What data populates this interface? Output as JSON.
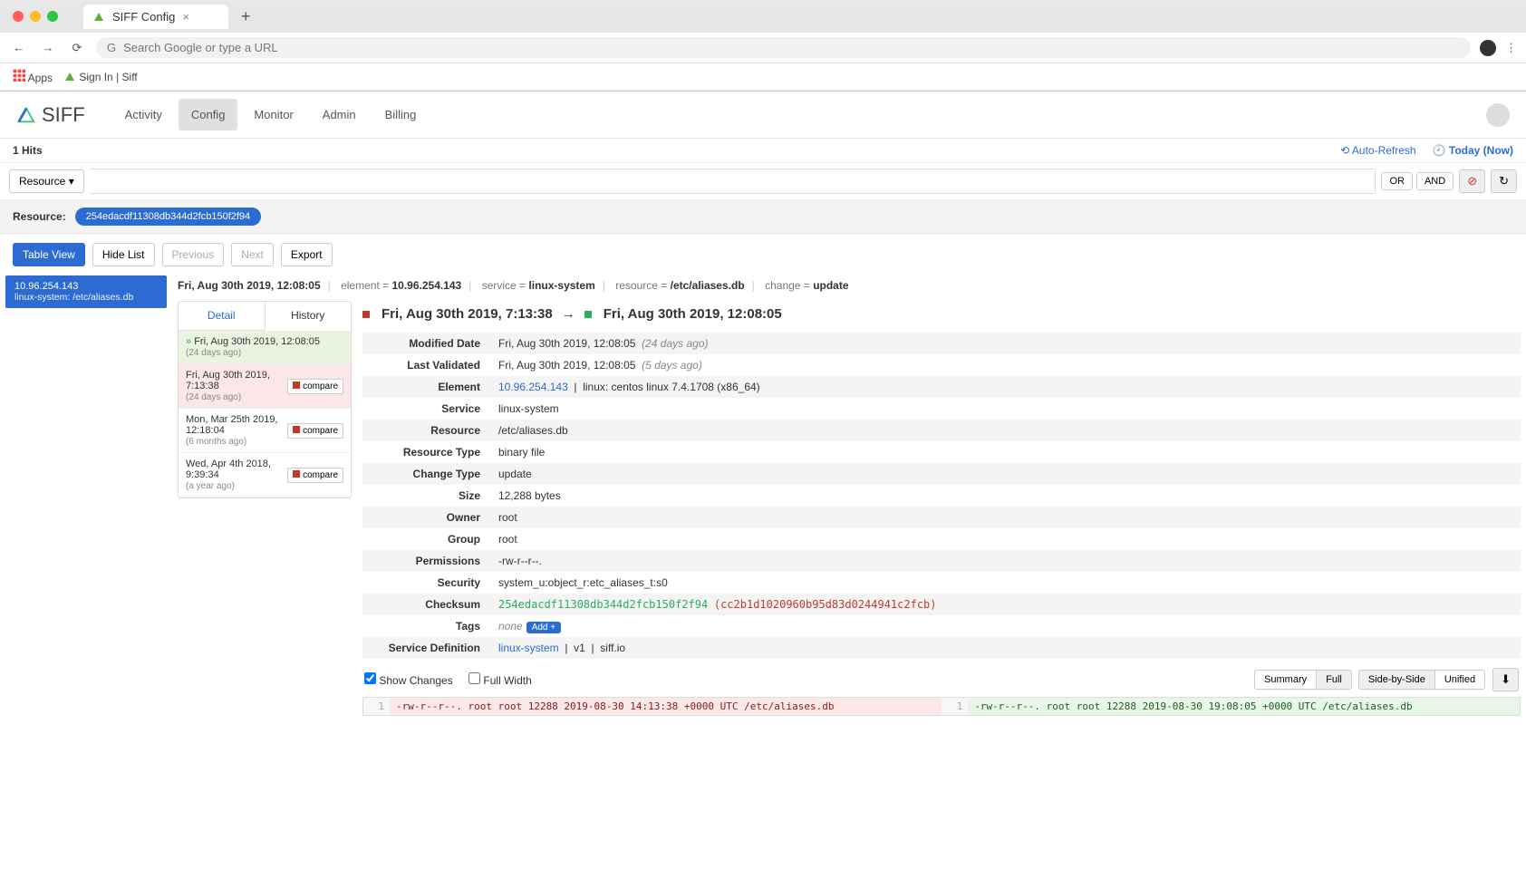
{
  "browser": {
    "tab_title": "SIFF Config",
    "omnibox_placeholder": "Search Google or type a URL",
    "bookmarks": {
      "apps": "Apps",
      "signin": "Sign In | Siff"
    }
  },
  "brand": "SIFF",
  "nav": {
    "activity": "Activity",
    "config": "Config",
    "monitor": "Monitor",
    "admin": "Admin",
    "billing": "Billing"
  },
  "subbar": {
    "hits": "1 Hits",
    "auto_refresh": "Auto-Refresh",
    "today": "Today (Now)"
  },
  "query": {
    "resource_btn": "Resource",
    "or": "OR",
    "and": "AND"
  },
  "filter": {
    "label": "Resource:",
    "value": "254edacdf11308db344d2fcb150f2f94"
  },
  "toolbar": {
    "table_view": "Table View",
    "hide_list": "Hide List",
    "previous": "Previous",
    "next": "Next",
    "export": "Export"
  },
  "left_card": {
    "ip": "10.96.254.143",
    "sub": "linux-system: /etc/aliases.db"
  },
  "breadcrumb": {
    "ts": "Fri, Aug 30th 2019, 12:08:05",
    "element_k": "element",
    "element_v": "10.96.254.143",
    "service_k": "service",
    "service_v": "linux-system",
    "resource_k": "resource",
    "resource_v": "/etc/aliases.db",
    "change_k": "change",
    "change_v": "update"
  },
  "tabs": {
    "detail": "Detail",
    "history": "History"
  },
  "history": [
    {
      "ts": "Fri, Aug 30th 2019, 12:08:05",
      "ago": "(24 days ago)",
      "state": "current"
    },
    {
      "ts": "Fri, Aug 30th 2019, 7:13:38",
      "ago": "(24 days ago)",
      "state": "compared",
      "btn": "compare"
    },
    {
      "ts": "Mon, Mar 25th 2019, 12:18:04",
      "ago": "(6 months ago)",
      "state": "",
      "btn": "compare"
    },
    {
      "ts": "Wed, Apr 4th 2018, 9:39:34",
      "ago": "(a year ago)",
      "state": "",
      "btn": "compare"
    }
  ],
  "compare": {
    "from": "Fri, Aug 30th 2019, 7:13:38",
    "arrow": "→",
    "to": "Fri, Aug 30th 2019, 12:08:05"
  },
  "details": {
    "modified_date_k": "Modified Date",
    "modified_date_v": "Fri, Aug 30th 2019, 12:08:05",
    "modified_date_ago": "(24 days ago)",
    "last_validated_k": "Last Validated",
    "last_validated_v": "Fri, Aug 30th 2019, 12:08:05",
    "last_validated_ago": "(5 days ago)",
    "element_k": "Element",
    "element_link": "10.96.254.143",
    "element_meta": "linux: centos linux 7.4.1708 (x86_64)",
    "service_k": "Service",
    "service_v": "linux-system",
    "resource_k": "Resource",
    "resource_v": "/etc/aliases.db",
    "resource_type_k": "Resource Type",
    "resource_type_v": "binary file",
    "change_type_k": "Change Type",
    "change_type_v": "update",
    "size_k": "Size",
    "size_v": "12,288 bytes",
    "owner_k": "Owner",
    "owner_v": "root",
    "group_k": "Group",
    "group_v": "root",
    "permissions_k": "Permissions",
    "permissions_v": "-rw-r--r--.",
    "security_k": "Security",
    "security_v": "system_u:object_r:etc_aliases_t:s0",
    "checksum_k": "Checksum",
    "checksum_new": "254edacdf11308db344d2fcb150f2f94",
    "checksum_old": "(cc2b1d1020960b95d83d0244941c2fcb)",
    "tags_k": "Tags",
    "tags_v": "none",
    "tags_add": "Add +",
    "svcdef_k": "Service Definition",
    "svcdef_link": "linux-system",
    "svcdef_v1": "v1",
    "svcdef_site": "siff.io"
  },
  "diff_ctrl": {
    "show_changes": "Show Changes",
    "full_width": "Full Width",
    "summary": "Summary",
    "full": "Full",
    "side": "Side-by-Side",
    "unified": "Unified"
  },
  "diff": {
    "line_no": "1",
    "old": "-rw-r--r--. root root 12288 2019-08-30 14:13:38 +0000 UTC /etc/aliases.db",
    "new": "-rw-r--r--. root root 12288 2019-08-30 19:08:05 +0000 UTC /etc/aliases.db"
  }
}
